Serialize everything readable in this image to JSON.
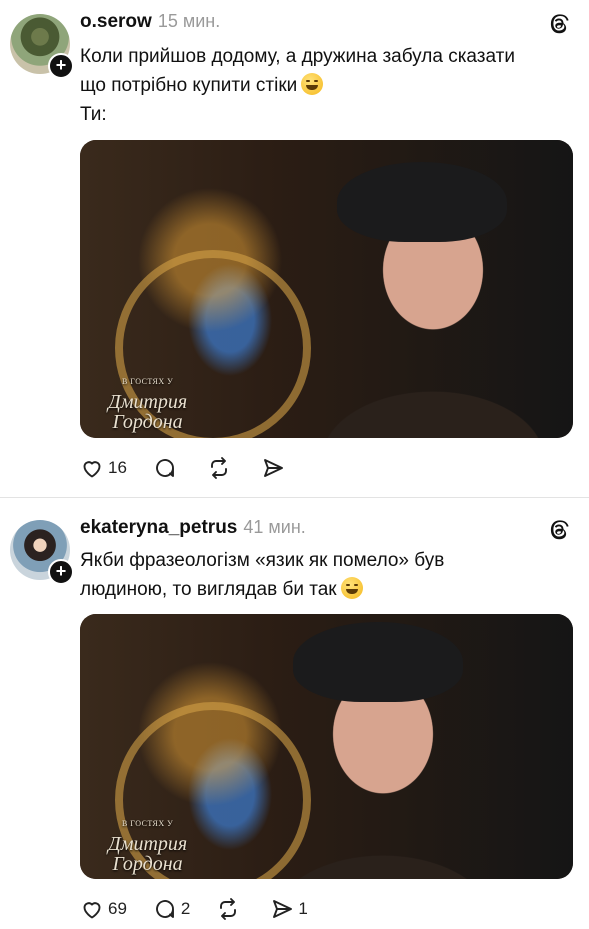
{
  "posts": [
    {
      "username": "o.serow",
      "time": "15 мин.",
      "text_lines": [
        "Коли прийшов додому, а дружина забула сказати",
        "що потрібно купити стіки",
        "Ти:"
      ],
      "media": {
        "watermark_top": "В ГОСТЯХ У",
        "watermark_line1": "Дмитрия",
        "watermark_line2": "Гордона"
      },
      "likes": "16",
      "comments": "",
      "reposts": "",
      "shares": ""
    },
    {
      "username": "ekateryna_petrus",
      "time": "41 мин.",
      "text_lines": [
        "Якби фразеологізм «язик як помело» був",
        "людиною, то виглядав би так"
      ],
      "media": {
        "watermark_top": "В ГОСТЯХ У",
        "watermark_line1": "Дмитрия",
        "watermark_line2": "Гордона"
      },
      "likes": "69",
      "comments": "2",
      "reposts": "",
      "shares": "1"
    }
  ],
  "icons": {
    "like": "heart-icon",
    "comment": "comment-icon",
    "repost": "repost-icon",
    "share": "share-icon",
    "threads": "threads-logo-icon",
    "follow": "plus-icon"
  }
}
